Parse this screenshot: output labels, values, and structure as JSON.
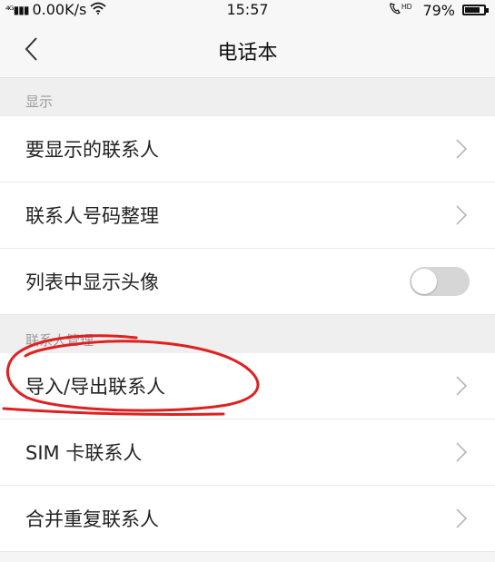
{
  "status_bar": {
    "signal": "4G",
    "speed": "0.00K/s",
    "time": "15:57",
    "hd_label": "HD",
    "battery": "79%",
    "battery_level": 0.79
  },
  "nav": {
    "title": "电话本",
    "back_icon": "chevron-left-icon"
  },
  "sections": [
    {
      "header": "显示",
      "items": [
        {
          "label": "要显示的联系人",
          "control": "chevron"
        },
        {
          "label": "联系人号码整理",
          "control": "chevron"
        },
        {
          "label": "列表中显示头像",
          "control": "toggle",
          "toggle_on": false
        }
      ]
    },
    {
      "header": "联系人管理",
      "items": [
        {
          "label": "导入/导出联系人",
          "control": "chevron"
        },
        {
          "label": "SIM 卡联系人",
          "control": "chevron"
        },
        {
          "label": "合并重复联系人",
          "control": "chevron"
        }
      ]
    }
  ],
  "colors": {
    "annotation": "#e02020",
    "toggle_off": "#d6d6d6",
    "section_header_text": "#9a9a9a"
  }
}
